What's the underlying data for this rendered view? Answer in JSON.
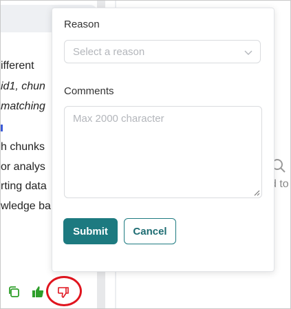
{
  "chat": {
    "lines": [
      {
        "text": "ifferent",
        "italic": false
      },
      {
        "text": "id1, chun",
        "italic": true
      },
      {
        "text": "matching",
        "italic": true
      },
      {
        "text": "h chunks",
        "italic": false
      },
      {
        "text": " or analys",
        "italic": false
      },
      {
        "text": "rting data",
        "italic": false
      },
      {
        "text": "wledge ba",
        "italic": false
      }
    ],
    "actions": {
      "copy": "copy-icon",
      "like": "thumbs-up-icon",
      "dislike": "thumbs-down-icon"
    },
    "like_color": "#2e9e2a",
    "dislike_color": "#e0141e"
  },
  "right_panel": {
    "hint_text": "d to"
  },
  "feedback": {
    "reason_label": "Reason",
    "reason_placeholder": "Select a reason",
    "comments_label": "Comments",
    "comments_placeholder": "Max 2000 character",
    "submit_label": "Submit",
    "cancel_label": "Cancel",
    "accent_color": "#1d7a80"
  }
}
